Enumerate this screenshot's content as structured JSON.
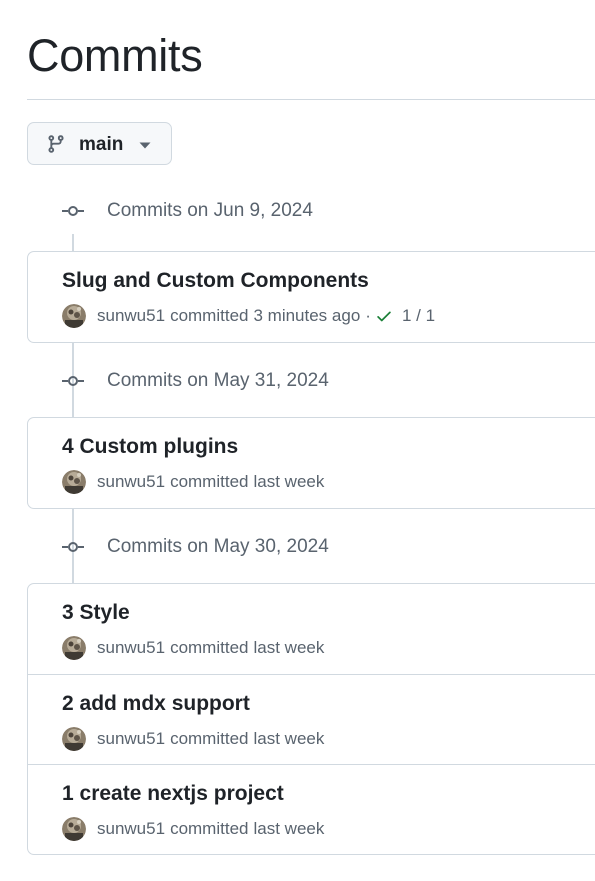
{
  "page": {
    "title": "Commits"
  },
  "branch": {
    "name": "main",
    "icon": "git-branch-icon",
    "caret": "triangle-down-icon"
  },
  "colors": {
    "text_primary": "#1f2328",
    "text_muted": "#59636e",
    "border": "#d1d9e0",
    "button_bg": "#f6f8fa",
    "success": "#1a7f37"
  },
  "groups": [
    {
      "label": "Commits on Jun 9, 2024",
      "commits": [
        {
          "title": "Slug and Custom Components",
          "author": "sunwu51",
          "action": "committed",
          "time": "3 minutes ago",
          "separator": "·",
          "checks": "1 / 1",
          "check_status": "success"
        }
      ]
    },
    {
      "label": "Commits on May 31, 2024",
      "commits": [
        {
          "title": "4 Custom plugins",
          "author": "sunwu51",
          "action": "committed",
          "time": "last week"
        }
      ]
    },
    {
      "label": "Commits on May 30, 2024",
      "commits": [
        {
          "title": "3 Style",
          "author": "sunwu51",
          "action": "committed",
          "time": "last week"
        },
        {
          "title": "2 add mdx support",
          "author": "sunwu51",
          "action": "committed",
          "time": "last week"
        },
        {
          "title": "1 create nextjs project",
          "author": "sunwu51",
          "action": "committed",
          "time": "last week"
        }
      ]
    }
  ]
}
